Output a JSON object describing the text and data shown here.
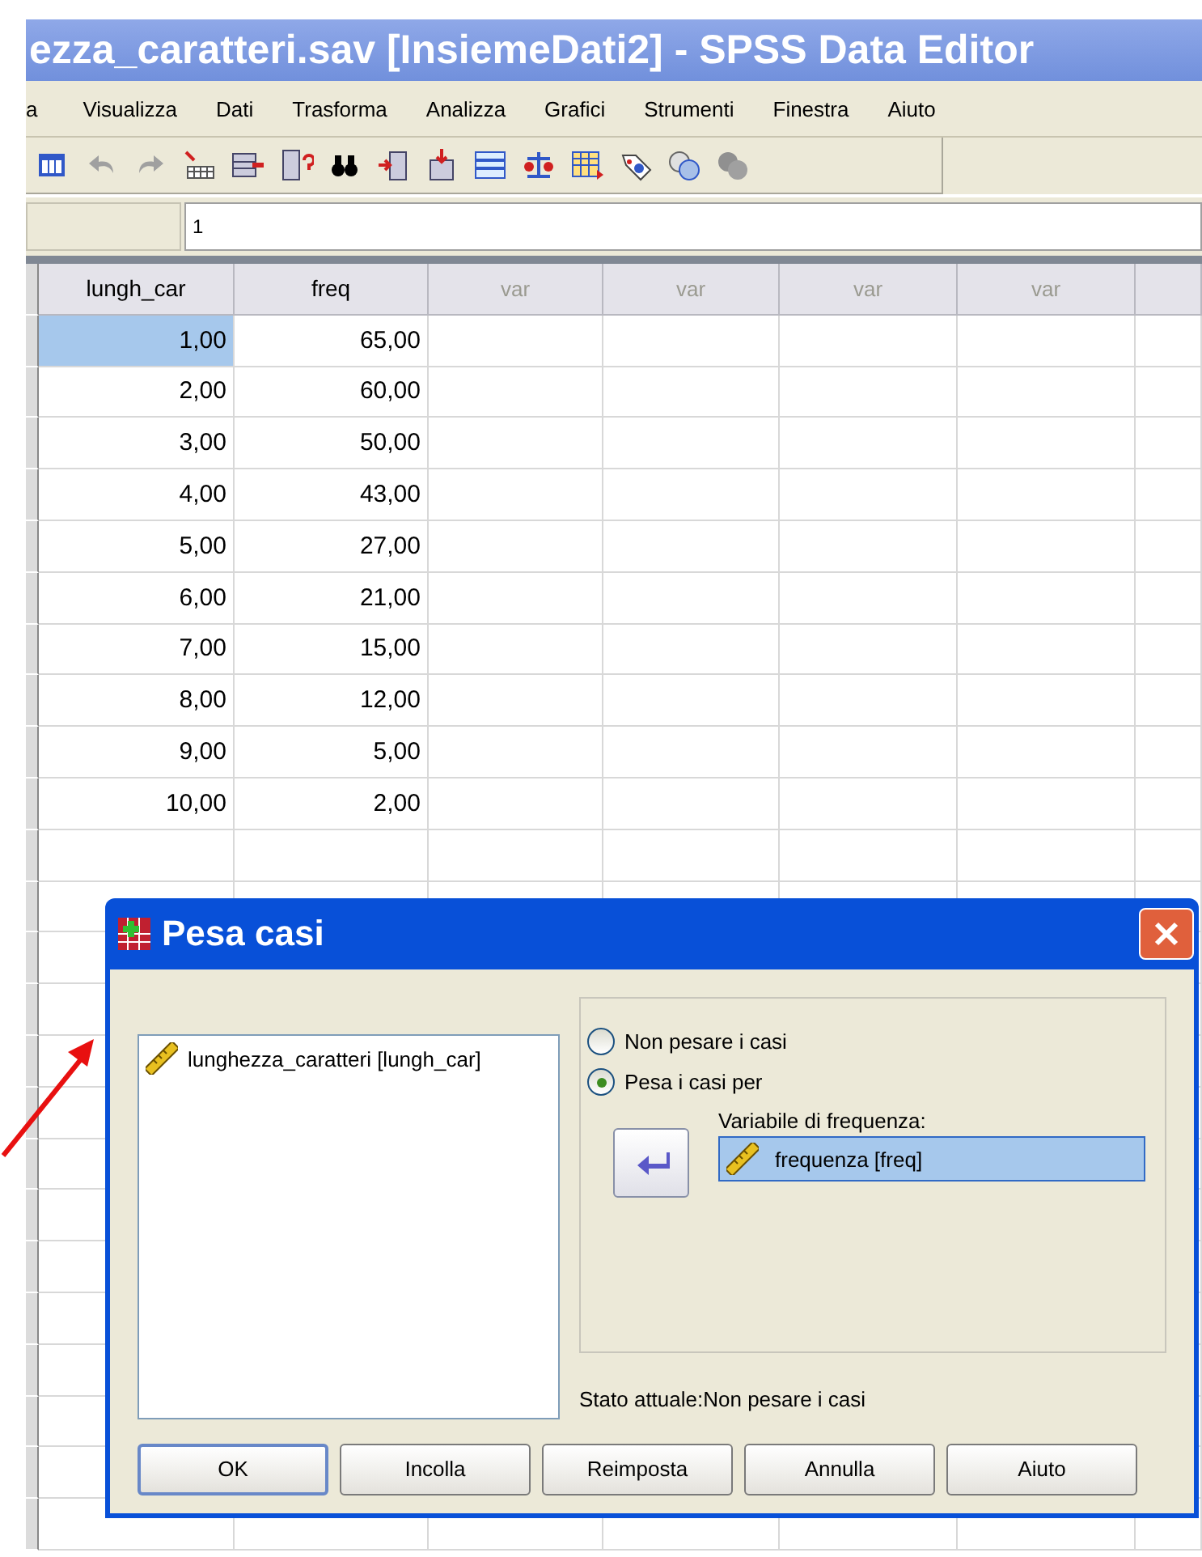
{
  "window": {
    "title": "ezza_caratteri.sav [InsiemeDati2] - SPSS Data Editor"
  },
  "menu": [
    "a",
    "Visualizza",
    "Dati",
    "Trasforma",
    "Analizza",
    "Grafici",
    "Strumenti",
    "Finestra",
    "Aiuto"
  ],
  "cell_editor": {
    "value": "1"
  },
  "table": {
    "columns": [
      "lungh_car",
      "freq",
      "var",
      "var",
      "var",
      "var"
    ],
    "rows": [
      {
        "lungh_car": "1,00",
        "freq": "65,00",
        "selected": true
      },
      {
        "lungh_car": "2,00",
        "freq": "60,00",
        "selected": false
      },
      {
        "lungh_car": "3,00",
        "freq": "50,00",
        "selected": false
      },
      {
        "lungh_car": "4,00",
        "freq": "43,00",
        "selected": false
      },
      {
        "lungh_car": "5,00",
        "freq": "27,00",
        "selected": false
      },
      {
        "lungh_car": "6,00",
        "freq": "21,00",
        "selected": false
      },
      {
        "lungh_car": "7,00",
        "freq": "15,00",
        "selected": false
      },
      {
        "lungh_car": "8,00",
        "freq": "12,00",
        "selected": false
      },
      {
        "lungh_car": "9,00",
        "freq": "5,00",
        "selected": false
      },
      {
        "lungh_car": "10,00",
        "freq": "2,00",
        "selected": false
      }
    ]
  },
  "dialog": {
    "title": "Pesa casi",
    "variables": [
      "lunghezza_caratteri [lungh_car]"
    ],
    "options": [
      {
        "label": "Non pesare i casi",
        "selected": false
      },
      {
        "label": "Pesa i casi per",
        "selected": true
      }
    ],
    "frequency_label": "Variabile di frequenza:",
    "frequency_variable": "frequenza [freq]",
    "status": "Stato attuale:Non pesare i casi",
    "buttons": [
      {
        "label": "OK",
        "default": true
      },
      {
        "label": "Incolla",
        "default": false
      },
      {
        "label": "Reimposta",
        "default": false
      },
      {
        "label": "Annulla",
        "default": false
      },
      {
        "label": "Aiuto",
        "default": false
      }
    ]
  }
}
